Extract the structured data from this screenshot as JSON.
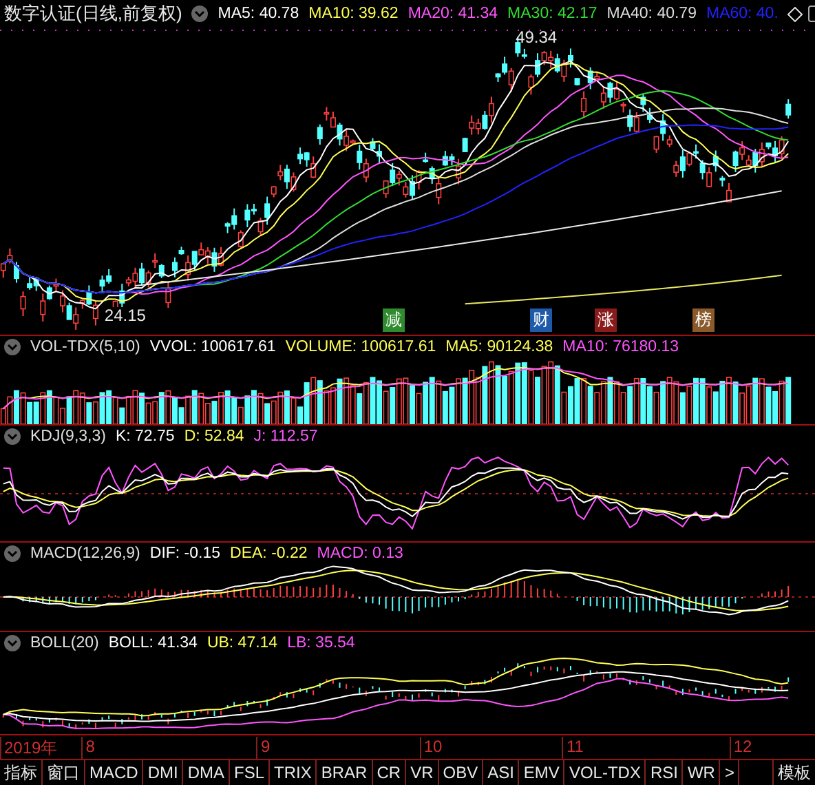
{
  "title": "数字认证(日线,前复权)",
  "main_legend": [
    {
      "label": "MA5: 40.78",
      "color": "#ffffff"
    },
    {
      "label": "MA10: 39.62",
      "color": "#ffff55"
    },
    {
      "label": "MA20: 41.34",
      "color": "#ff55ff"
    },
    {
      "label": "MA30: 42.17",
      "color": "#33dd33"
    },
    {
      "label": "MA40: 40.79",
      "color": "#dddddd"
    },
    {
      "label": "MA60: 40.",
      "color": "#2222ff"
    }
  ],
  "high_label": "49.34",
  "low_label": "24.15",
  "event_markers": [
    {
      "text": "减",
      "color": "#2e8b2e"
    },
    {
      "text": "财",
      "color": "#1e5aa8"
    },
    {
      "text": "涨",
      "color": "#8b1a1a"
    },
    {
      "text": "榜",
      "color": "#8b5a2b"
    }
  ],
  "indicators": [
    {
      "kind": "vol",
      "name": "VOL-TDX(5,10)",
      "values": [
        {
          "label": "VVOL: 100617.61",
          "color": "#ffffff"
        },
        {
          "label": "VOLUME: 100617.61",
          "color": "#ffff55"
        },
        {
          "label": "MA5: 90124.38",
          "color": "#ffff55"
        },
        {
          "label": "MA10: 76180.13",
          "color": "#ff55ff"
        }
      ]
    },
    {
      "kind": "kdj",
      "name": "KDJ(9,3,3)",
      "values": [
        {
          "label": "K: 72.75",
          "color": "#ffffff"
        },
        {
          "label": "D: 52.84",
          "color": "#ffff55"
        },
        {
          "label": "J: 112.57",
          "color": "#ff55ff"
        }
      ]
    },
    {
      "kind": "macd",
      "name": "MACD(12,26,9)",
      "values": [
        {
          "label": "DIF: -0.15",
          "color": "#ffffff"
        },
        {
          "label": "DEA: -0.22",
          "color": "#ffff55"
        },
        {
          "label": "MACD: 0.13",
          "color": "#ff55ff"
        }
      ]
    },
    {
      "kind": "boll",
      "name": "BOLL(20)",
      "values": [
        {
          "label": "BOLL: 41.34",
          "color": "#ffffff"
        },
        {
          "label": "UB: 47.14",
          "color": "#ffff55"
        },
        {
          "label": "LB: 35.54",
          "color": "#ff55ff"
        }
      ]
    }
  ],
  "date_axis": [
    "2019年",
    "8",
    "9",
    "10",
    "11",
    "12"
  ],
  "tabs": [
    "指标",
    "窗口",
    "MACD",
    "DMI",
    "DMA",
    "FSL",
    "TRIX",
    "BRAR",
    "CR",
    "VR",
    "OBV",
    "ASI",
    "EMV",
    "VOL-TDX",
    "RSI",
    "WR",
    ">"
  ],
  "template_tab": "模板"
}
